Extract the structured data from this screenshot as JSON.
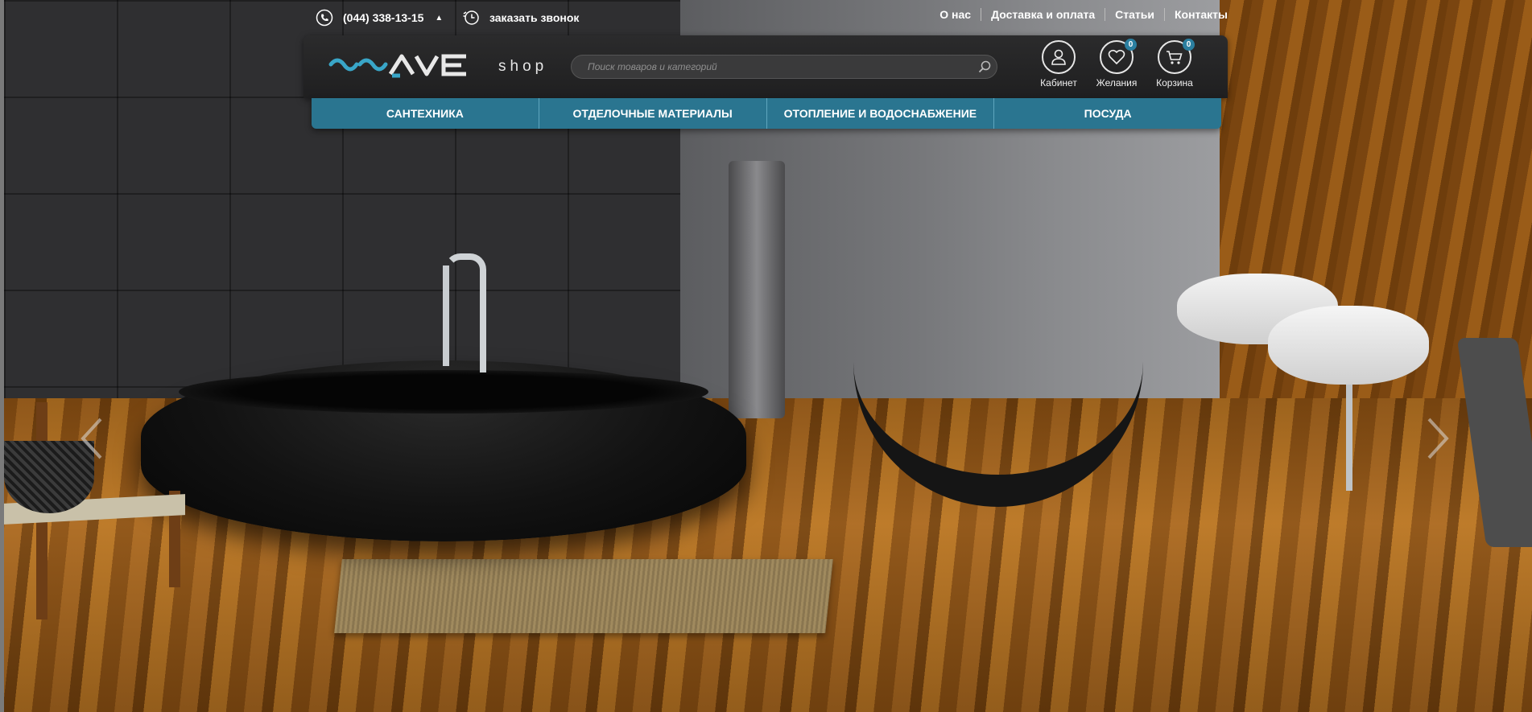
{
  "topbar": {
    "phone": "(044) 338-13-15",
    "phone_caret": "▲",
    "callback": "заказать звонок",
    "links": [
      "О нас",
      "Доставка и оплата",
      "Статьи",
      "Контакты"
    ]
  },
  "header": {
    "logo_shop": "shop",
    "logo_word": "WAVE",
    "search_placeholder": "Поиск товаров и категорий",
    "account_label": "Кабинет",
    "wishlist_label": "Желания",
    "wishlist_count": "0",
    "cart_label": "Корзина",
    "cart_count": "0"
  },
  "nav": {
    "items": [
      "САНТЕХНИКА",
      "ОТДЕЛОЧНЫЕ МАТЕРИАЛЫ",
      "ОТОПЛЕНИЕ И ВОДОСНАБЖЕНИЕ",
      "ПОСУДА"
    ]
  },
  "icons": {
    "phone": "phone-icon",
    "callback": "callback-clock-icon",
    "search": "search-icon",
    "account": "user-icon",
    "wishlist": "heart-icon",
    "cart": "cart-icon",
    "prev": "chevron-left-icon",
    "next": "chevron-right-icon"
  },
  "colors": {
    "nav_bg": "#2a7590",
    "header_bg": "#252526",
    "badge": "#2b7fa0",
    "logo_accent": "#39a6c8"
  }
}
